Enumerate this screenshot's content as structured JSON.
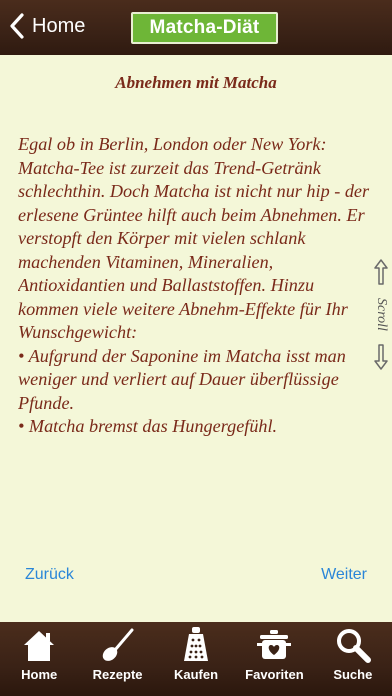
{
  "nav": {
    "back_label": "Home",
    "app_title": "Matcha-Diät"
  },
  "article": {
    "title": "Abnehmen mit Matcha",
    "body": "Egal ob in Berlin, London oder New York: Matcha-Tee ist zurzeit das Trend-Getränk schlechthin. Doch Matcha ist nicht nur hip - der erlesene Grüntee hilft auch beim Abnehmen. Er verstopft den Körper mit vielen schlank machenden Vitaminen, Mineralien, Antioxidantien und Ballaststoffen. Hinzu kommen viele weitere Abnehm-Effekte für Ihr Wunschgewicht:\n• Aufgrund der Saponine im Matcha isst man weniger und verliert auf Dauer überflüssige Pfunde.\n• Matcha bremst das Hungergefühl."
  },
  "scroll_hint": {
    "label": "Scroll"
  },
  "pager": {
    "prev_label": "Zurück",
    "next_label": "Weiter"
  },
  "tabbar": {
    "items": [
      {
        "label": "Home",
        "icon": "house-icon"
      },
      {
        "label": "Rezepte",
        "icon": "ladle-icon"
      },
      {
        "label": "Kaufen",
        "icon": "grater-icon"
      },
      {
        "label": "Favoriten",
        "icon": "pot-icon"
      },
      {
        "label": "Suche",
        "icon": "magnifier-icon"
      }
    ]
  },
  "colors": {
    "bar_brown": "#3a2216",
    "badge_green": "#6eb637",
    "page_bg": "#f4f7d8",
    "text_red_brown": "#7a2a1a",
    "link_blue": "#2a86d8"
  }
}
